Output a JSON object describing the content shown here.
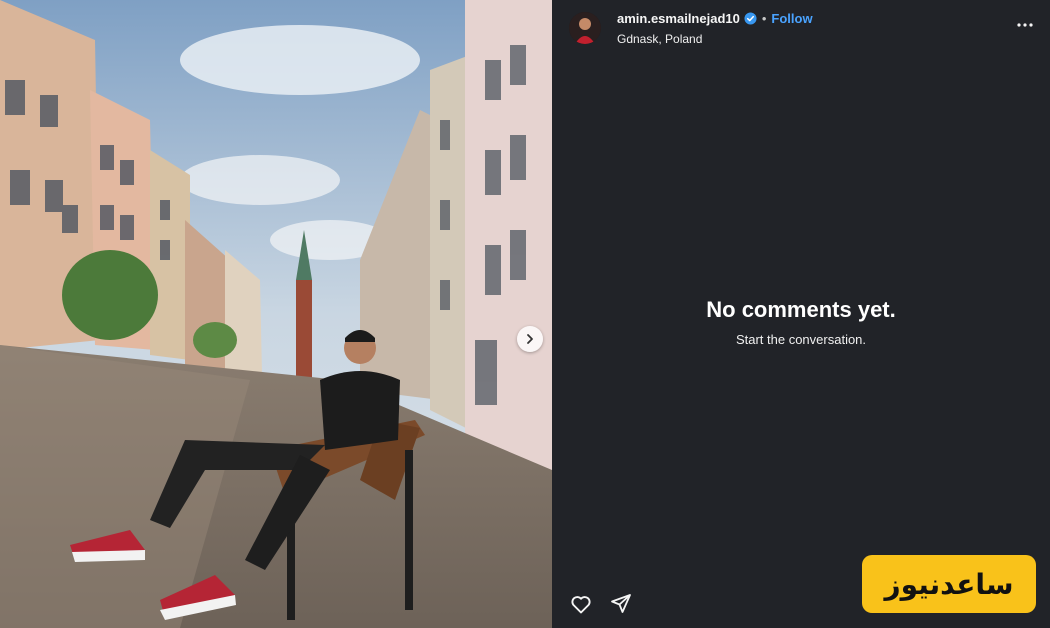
{
  "post": {
    "username": "amin.esmailnejad10",
    "separator": "•",
    "follow_label": "Follow",
    "location": "Gdnask, Poland"
  },
  "comments": {
    "empty_title": "No comments yet.",
    "empty_subtitle": "Start the conversation."
  },
  "icons": {
    "more": "more-options-icon",
    "like": "heart-icon",
    "share": "share-icon",
    "next": "chevron-right-icon",
    "verified": "verified-badge-icon"
  },
  "watermark": {
    "text": "ساعدنیوز"
  },
  "colors": {
    "panel_bg": "#212328",
    "accent": "#4aa3ff",
    "watermark_bg": "#f9c21a"
  }
}
